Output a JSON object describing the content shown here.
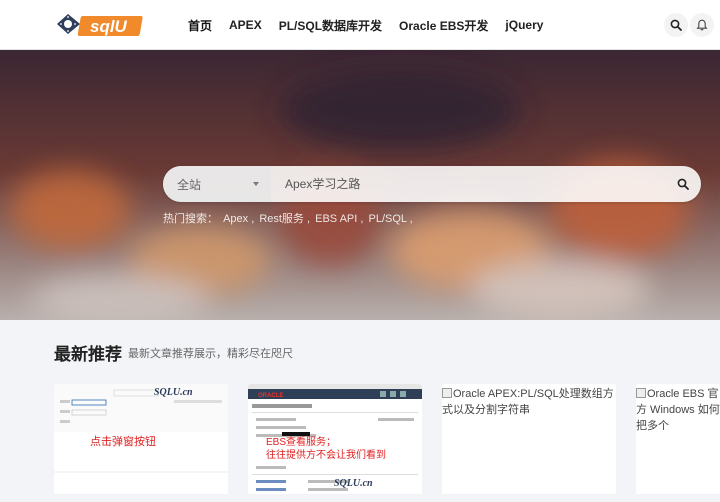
{
  "header": {
    "logo_text": "sqlU",
    "nav": [
      {
        "label": "首页",
        "active": true
      },
      {
        "label": "APEX"
      },
      {
        "label": "PL/SQL数据库开发"
      },
      {
        "label": "Oracle EBS开发"
      },
      {
        "label": "jQuery"
      }
    ]
  },
  "hero": {
    "scope_label": "全站",
    "search_placeholder": "Apex学习之路",
    "hot_label": "热门搜索：",
    "hot_terms": [
      "Apex ,",
      "Rest服务 ,",
      "EBS API ,",
      "PL/SQL ,"
    ]
  },
  "latest": {
    "title": "最新推荐",
    "subtitle": "最新文章推荐展示，精彩尽在咫尺",
    "cards": [
      {
        "thumb_brand": "SQLU.cn",
        "caption": "点击弹窗按钮"
      },
      {
        "thumb_brand": "SQLU.cn",
        "caption_line1": "EBS查看服务；",
        "caption_line2": "往往提供方不会让我们看到",
        "oracle_label": "ORACLE"
      },
      {
        "alt": "Oracle APEX:PL/SQL处理数组方式以及分割字符串"
      },
      {
        "alt": "Oracle EBS 官方 Windows 如何把多个"
      }
    ]
  },
  "colors": {
    "accent": "#e8642c",
    "brand_blue": "#2a6bb5",
    "red_caption": "#e02020"
  },
  "icons": {
    "search": "search-icon",
    "bell": "bell-icon",
    "caret": "caret-down-icon"
  }
}
